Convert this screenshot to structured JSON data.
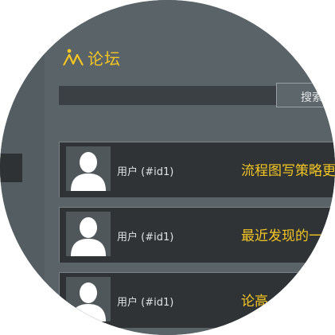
{
  "header": {
    "title": "论坛",
    "logo_icon": "forum-logo-icon"
  },
  "search": {
    "button_label": "搜索"
  },
  "posts": [
    {
      "user": "用户 (#id1)",
      "title": "流程图写策略更"
    },
    {
      "user": "用户 (#id1)",
      "title": "最近发现的一"
    },
    {
      "user": "用户 (#id1)",
      "title": "论高"
    }
  ],
  "colors": {
    "accent": "#f5c623",
    "post_bg": "#2f3335",
    "panel_bg": "#5a6367"
  }
}
